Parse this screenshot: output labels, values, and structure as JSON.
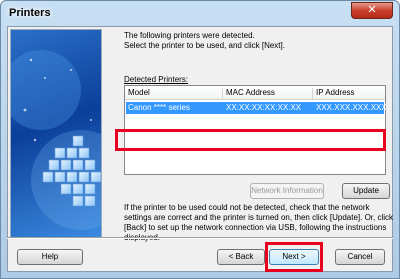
{
  "window": {
    "title": "Printers",
    "close_glyph": "✕"
  },
  "intro": {
    "line1": "The following printers were detected.",
    "line2": "Select the printer to be used, and click [Next]."
  },
  "detected_label": "Detected Printers:",
  "table": {
    "columns": [
      "Model",
      "MAC Address",
      "IP Address"
    ],
    "rows": [
      {
        "model": "Canon  ****  series",
        "mac": "XX:XX:XX:XX:XX:XX",
        "ip": "XXX.XXX.XXX.XXX",
        "selected": true
      }
    ]
  },
  "buttons": {
    "network_information": "Network Information",
    "update": "Update",
    "help": "Help",
    "back": "< Back",
    "next": "Next >",
    "cancel": "Cancel"
  },
  "note": "If the printer to be used could not be detected, check that the network settings are correct and the printer is turned on, then click [Update]. Or, click [Back] to set up the network connection via USB, following the instructions displayed.",
  "colors": {
    "selection": "#3399ff",
    "annotation_red": "#e8001e",
    "side_art": "#1e5fb8"
  },
  "icons": {
    "close": "close-icon",
    "side_art": "cubes-illustration"
  }
}
